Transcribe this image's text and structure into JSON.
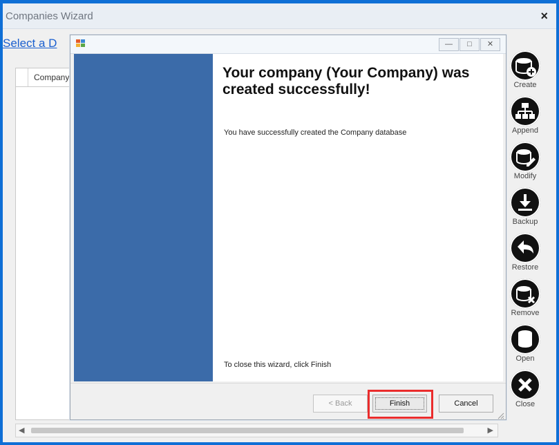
{
  "outer_window": {
    "title": "Companies Wizard",
    "close_label": "×",
    "select_link": "Select a D",
    "grid_header": "Company"
  },
  "side_tools": [
    {
      "label": "Create",
      "icon": "database-add-icon"
    },
    {
      "label": "Append",
      "icon": "hierarchy-icon"
    },
    {
      "label": "Modify",
      "icon": "edit-icon"
    },
    {
      "label": "Backup",
      "icon": "download-icon"
    },
    {
      "label": "Restore",
      "icon": "undo-icon"
    },
    {
      "label": "Remove",
      "icon": "database-remove-icon"
    },
    {
      "label": "Open",
      "icon": "database-open-icon"
    },
    {
      "label": "Close",
      "icon": "close-circle-icon"
    }
  ],
  "dialog": {
    "title_buttons": {
      "minimize": "—",
      "maximize": "□",
      "close": "✕"
    },
    "heading": "Your company (Your Company) was created successfully!",
    "body": "You have successfully created the Company database",
    "close_hint": "To close this wizard, click Finish",
    "buttons": {
      "back": "< Back",
      "finish": "Finish",
      "cancel": "Cancel"
    }
  },
  "colors": {
    "banner_blue": "#3b6ba9",
    "window_border_blue": "#0f6fd6",
    "highlight_red": "#ea2c2c"
  }
}
